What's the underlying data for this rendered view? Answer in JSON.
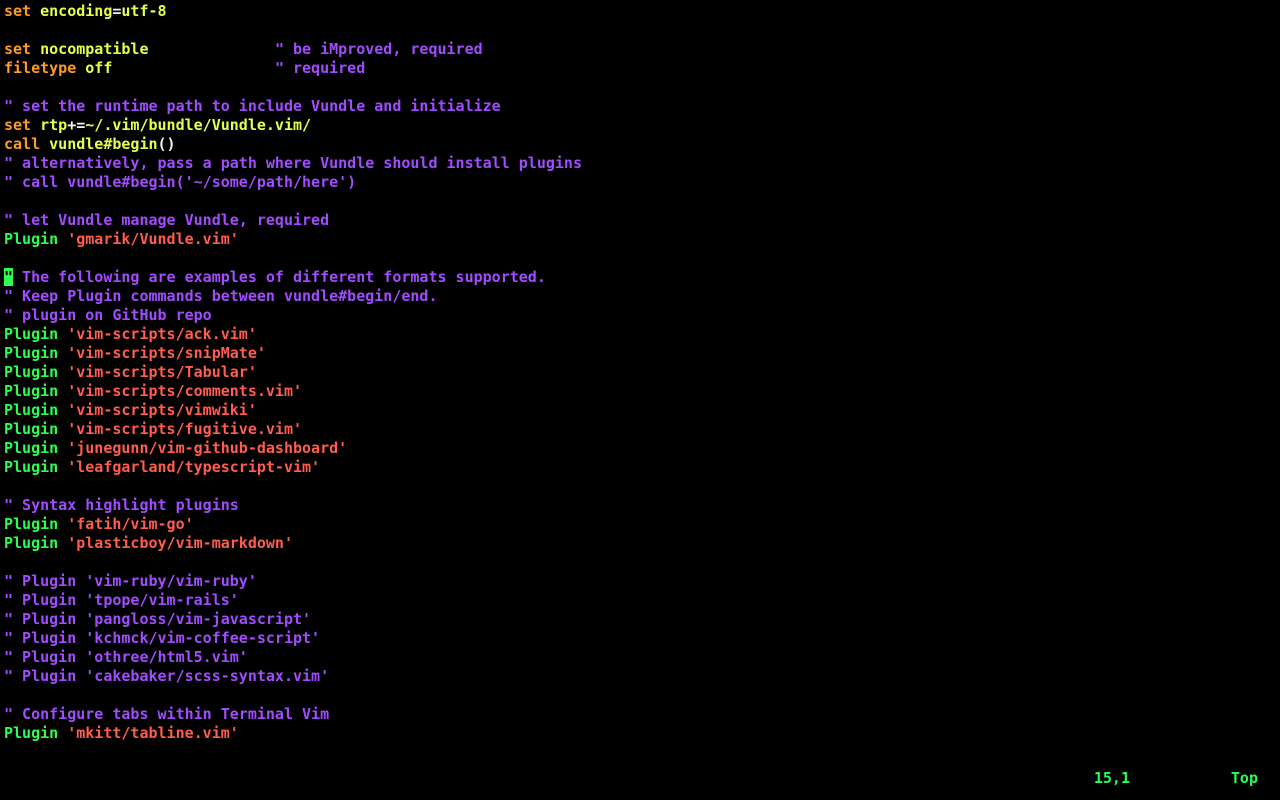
{
  "colors": {
    "keyword": "#ff9a26",
    "option": "#e8fe4d",
    "comment": "#a14dff",
    "command": "#2bfe4e",
    "string": "#ff5d4d",
    "cursor_bg": "#2bfe4e"
  },
  "lines": [
    [
      [
        "c-orange",
        "set"
      ],
      [
        "c-white",
        " "
      ],
      [
        "c-yellow",
        "encoding"
      ],
      [
        "c-white",
        "="
      ],
      [
        "c-yellow",
        "utf-8"
      ]
    ],
    [
      [
        "",
        ""
      ]
    ],
    [
      [
        "c-orange",
        "set"
      ],
      [
        "c-white",
        " "
      ],
      [
        "c-yellow",
        "nocompatible"
      ],
      [
        "c-white",
        "              "
      ],
      [
        "c-purple",
        "\" be iMproved, required"
      ]
    ],
    [
      [
        "c-orange",
        "filetype"
      ],
      [
        "c-white",
        " "
      ],
      [
        "c-yellow",
        "off"
      ],
      [
        "c-white",
        "                  "
      ],
      [
        "c-purple",
        "\" required"
      ]
    ],
    [
      [
        "",
        ""
      ]
    ],
    [
      [
        "c-purple",
        "\" set the runtime path to include Vundle and initialize"
      ]
    ],
    [
      [
        "c-orange",
        "set"
      ],
      [
        "c-white",
        " "
      ],
      [
        "c-yellow",
        "rtp"
      ],
      [
        "c-white",
        "+="
      ],
      [
        "c-yellow",
        "~/.vim/bundle/Vundle.vim/"
      ]
    ],
    [
      [
        "c-orange",
        "call"
      ],
      [
        "c-white",
        " "
      ],
      [
        "c-yellow",
        "vundle#begin"
      ],
      [
        "c-white",
        "()"
      ]
    ],
    [
      [
        "c-purple",
        "\" alternatively, pass a path where Vundle should install plugins"
      ]
    ],
    [
      [
        "c-purple",
        "\" call vundle#begin('~/some/path/here')"
      ]
    ],
    [
      [
        "",
        ""
      ]
    ],
    [
      [
        "c-purple",
        "\" let Vundle manage Vundle, required"
      ]
    ],
    [
      [
        "c-green",
        "Plugin"
      ],
      [
        "c-white",
        " "
      ],
      [
        "c-coral",
        "'gmarik/Vundle.vim'"
      ]
    ],
    [
      [
        "",
        ""
      ]
    ],
    [
      [
        "cursor",
        "\""
      ],
      [
        "c-purple",
        " The following are examples of different formats supported."
      ]
    ],
    [
      [
        "c-purple",
        "\" Keep Plugin commands between vundle#begin/end."
      ]
    ],
    [
      [
        "c-purple",
        "\" plugin on GitHub repo"
      ]
    ],
    [
      [
        "c-green",
        "Plugin"
      ],
      [
        "c-white",
        " "
      ],
      [
        "c-coral",
        "'vim-scripts/ack.vim'"
      ]
    ],
    [
      [
        "c-green",
        "Plugin"
      ],
      [
        "c-white",
        " "
      ],
      [
        "c-coral",
        "'vim-scripts/snipMate'"
      ]
    ],
    [
      [
        "c-green",
        "Plugin"
      ],
      [
        "c-white",
        " "
      ],
      [
        "c-coral",
        "'vim-scripts/Tabular'"
      ]
    ],
    [
      [
        "c-green",
        "Plugin"
      ],
      [
        "c-white",
        " "
      ],
      [
        "c-coral",
        "'vim-scripts/comments.vim'"
      ]
    ],
    [
      [
        "c-green",
        "Plugin"
      ],
      [
        "c-white",
        " "
      ],
      [
        "c-coral",
        "'vim-scripts/vimwiki'"
      ]
    ],
    [
      [
        "c-green",
        "Plugin"
      ],
      [
        "c-white",
        " "
      ],
      [
        "c-coral",
        "'vim-scripts/fugitive.vim'"
      ]
    ],
    [
      [
        "c-green",
        "Plugin"
      ],
      [
        "c-white",
        " "
      ],
      [
        "c-coral",
        "'junegunn/vim-github-dashboard'"
      ]
    ],
    [
      [
        "c-green",
        "Plugin"
      ],
      [
        "c-white",
        " "
      ],
      [
        "c-coral",
        "'leafgarland/typescript-vim'"
      ]
    ],
    [
      [
        "",
        ""
      ]
    ],
    [
      [
        "c-purple",
        "\" Syntax highlight plugins"
      ]
    ],
    [
      [
        "c-green",
        "Plugin"
      ],
      [
        "c-white",
        " "
      ],
      [
        "c-coral",
        "'fatih/vim-go'"
      ]
    ],
    [
      [
        "c-green",
        "Plugin"
      ],
      [
        "c-white",
        " "
      ],
      [
        "c-coral",
        "'plasticboy/vim-markdown'"
      ]
    ],
    [
      [
        "",
        ""
      ]
    ],
    [
      [
        "c-purple",
        "\" Plugin 'vim-ruby/vim-ruby'"
      ]
    ],
    [
      [
        "c-purple",
        "\" Plugin 'tpope/vim-rails'"
      ]
    ],
    [
      [
        "c-purple",
        "\" Plugin 'pangloss/vim-javascript'"
      ]
    ],
    [
      [
        "c-purple",
        "\" Plugin 'kchmck/vim-coffee-script'"
      ]
    ],
    [
      [
        "c-purple",
        "\" Plugin 'othree/html5.vim'"
      ]
    ],
    [
      [
        "c-purple",
        "\" Plugin 'cakebaker/scss-syntax.vim'"
      ]
    ],
    [
      [
        "",
        ""
      ]
    ],
    [
      [
        "c-purple",
        "\" Configure tabs within Terminal Vim"
      ]
    ],
    [
      [
        "c-green",
        "Plugin"
      ],
      [
        "c-white",
        " "
      ],
      [
        "c-coral",
        "'mkitt/tabline.vim'"
      ]
    ]
  ],
  "ruler": {
    "position": "15,1",
    "scroll": "Top"
  }
}
